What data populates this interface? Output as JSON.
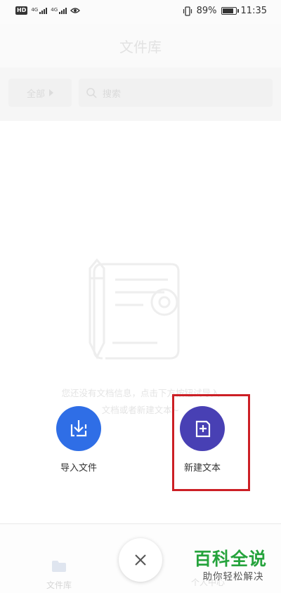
{
  "status_bar": {
    "hd_badge": "HD",
    "network_1": "4G",
    "network_2": "4G",
    "battery_percent": "89%",
    "battery_level": 0.89,
    "time": "11:35",
    "icons": [
      "eye-icon",
      "vibrate-icon",
      "battery-icon"
    ]
  },
  "header": {
    "title": "文件库"
  },
  "filter": {
    "all_label": "全部",
    "search_placeholder": "搜索"
  },
  "empty_state": {
    "line1": "您还没有文档信息，点击下方按钮试导入",
    "line2": "文档或者新建文本~"
  },
  "actions": {
    "import_label": "导入文件",
    "new_label": "新建文本"
  },
  "bottom_nav": {
    "library_label": "文件库",
    "right_label": "个人中心"
  },
  "watermark": {
    "main": "百科全说",
    "sub": "助你轻松解决"
  },
  "colors": {
    "import_button": "#2f6ee6",
    "new_button": "#4840b4",
    "highlight_box": "#cc1f25",
    "watermark": "#25a33c"
  }
}
